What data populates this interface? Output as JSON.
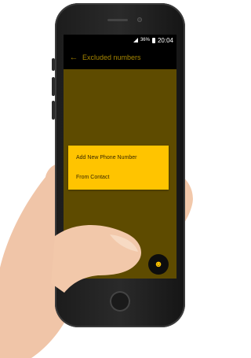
{
  "status_bar": {
    "battery_percent": "36%",
    "time": "20:04"
  },
  "toolbar": {
    "title": "Excluded numbers"
  },
  "menu": {
    "items": [
      {
        "label": "Add New Phone Number"
      },
      {
        "label": "From Contact"
      }
    ]
  },
  "icons": {
    "back": "back-arrow-icon",
    "fab": "contact-add-icon"
  },
  "colors": {
    "accent": "#ffc400",
    "background": "#5e4b00",
    "toolbar": "#000000"
  }
}
